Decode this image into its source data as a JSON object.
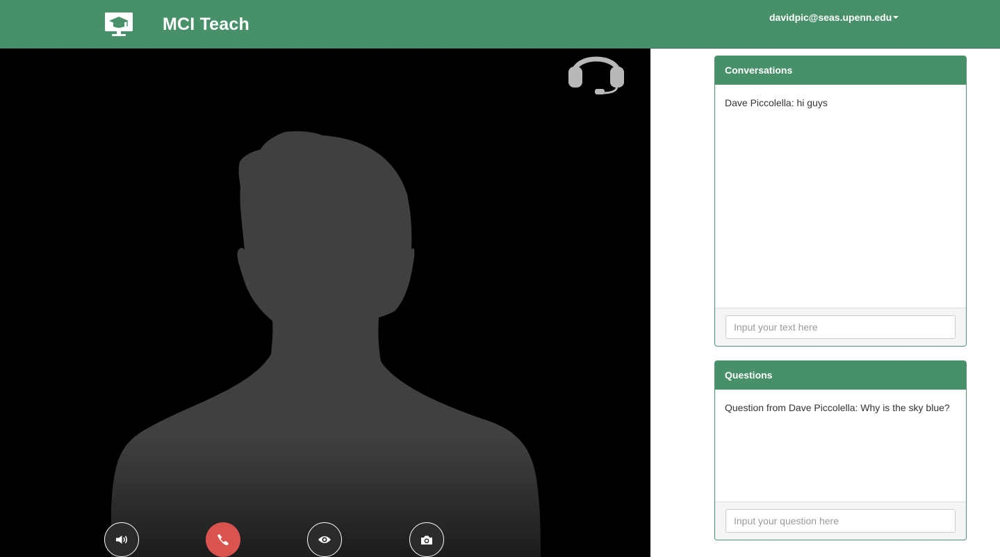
{
  "colors": {
    "brand": "#47906a",
    "danger": "#d9534f",
    "video_background": "#000000",
    "silhouette": "#404040"
  },
  "navbar": {
    "logo_icon": "graduation-cap-monitor-icon",
    "brand_name": "MCI Teach",
    "user_email": "davidpic@seas.upenn.edu"
  },
  "video": {
    "headset_icon": "headset-icon",
    "controls": [
      {
        "name": "volume-button",
        "icon": "volume-icon"
      },
      {
        "name": "hangup-button",
        "icon": "phone-icon"
      },
      {
        "name": "view-button",
        "icon": "eye-icon"
      },
      {
        "name": "snapshot-button",
        "icon": "camera-icon"
      }
    ]
  },
  "conversations": {
    "title": "Conversations",
    "messages": [
      "Dave Piccolella: hi guys"
    ],
    "input_placeholder": "Input your text here"
  },
  "questions": {
    "title": "Questions",
    "items": [
      "Question from Dave Piccolella: Why is the sky blue?"
    ],
    "input_placeholder": "Input your question here"
  }
}
